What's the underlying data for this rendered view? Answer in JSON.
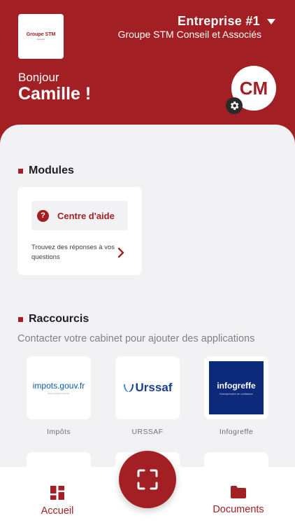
{
  "header": {
    "logo_title": "Groupe STM",
    "logo_subtitle": "conseil",
    "company_name": "Entreprise #1",
    "company_subtitle": "Groupe STM Conseil et Associés",
    "greeting": "Bonjour",
    "username": "Camille !",
    "avatar_initials": "CM"
  },
  "modules": {
    "title": "Modules",
    "help_card": {
      "label": "Centre d'aide",
      "icon": "question-icon",
      "description": "Trouvez des réponses à vos questions"
    }
  },
  "shortcuts": {
    "title": "Raccourcis",
    "hint": "Contacter votre cabinet pour ajouter des applications",
    "items": [
      {
        "label": "Impôts",
        "logo_text": "impots.gouv.fr",
        "logo_tagline": "liberté égalité fraternité"
      },
      {
        "label": "URSSAF",
        "logo_text": "Urssaf"
      },
      {
        "label": "Infogreffe",
        "logo_text": "infogreffe",
        "logo_tagline": "Entreprendre en confiance"
      }
    ]
  },
  "tabbar": {
    "home_label": "Accueil",
    "documents_label": "Documents",
    "scan_icon": "scan-icon"
  },
  "colors": {
    "brand": "#a21f23",
    "background": "#f2f2f4",
    "infogreffe_blue": "#0d2a7a",
    "urssaf_blue": "#1a3f8f"
  }
}
